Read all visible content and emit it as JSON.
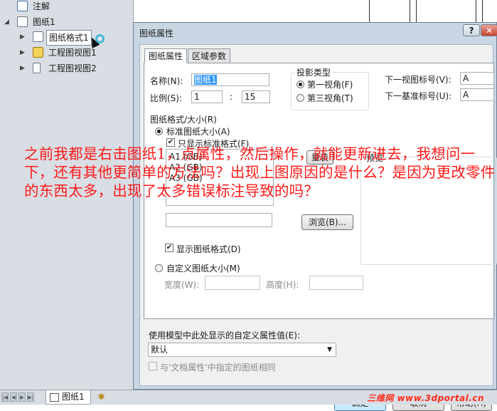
{
  "tree": {
    "annotations": "注解",
    "sheet": "图纸1",
    "sheet_format": "图纸格式1",
    "view1": "工程图视图1",
    "view2": "工程图视图2"
  },
  "tabbar": {
    "sheet_tab": "图纸1",
    "watermark": "三维网 www.3dportal.cn"
  },
  "dialog": {
    "title": "图纸属性",
    "help_label": "?",
    "close_label": "✕",
    "tabs": [
      "图纸属性",
      "区域参数"
    ],
    "name_label": "名称(N):",
    "name_value": "图纸1",
    "scale_label": "比例(S):",
    "scale_num": "1",
    "scale_sep": ":",
    "scale_den": "15",
    "projection": {
      "title": "投影类型",
      "first_angle": "第一视角(F)",
      "third_angle": "第三视角(T)",
      "selected": "first_angle"
    },
    "next_view_label": "下一视图标号(V):",
    "next_view_value": "A",
    "next_datum_label": "下一基准标号(U):",
    "next_datum_value": "A",
    "format_group": "图纸格式/大小(R)",
    "standard_size": "标准图纸大小(A)",
    "only_standard": "只显示标准格式(F)",
    "list_items": [
      "A1 (GB)",
      "A2 (GB)",
      "A3 (GB)"
    ],
    "reload_label": "重装",
    "browse_label": "浏览(B)...",
    "show_format": "显示图纸格式(D)",
    "preview_label": "预览",
    "custom_size": "自定义图纸大小(M)",
    "width_label": "宽度(W):",
    "height_label": "高度(H):",
    "custom_prop_label": "使用模型中此处显示的自定义属性值(E):",
    "custom_prop_value": "默认",
    "same_as_doc": "与'文档属性'中指定的图纸相同",
    "ok_label": "确定",
    "cancel_label": "取消",
    "help_button_label": "帮助(H)"
  },
  "question_text": "之前我都是右击图纸1，点属性，然后操作，就能更新进去，我想问一下，还有其他更简单的方法吗？出现上图原因的是什么？是因为更改零件的东西太多，出现了太多错误标注导致的吗？"
}
